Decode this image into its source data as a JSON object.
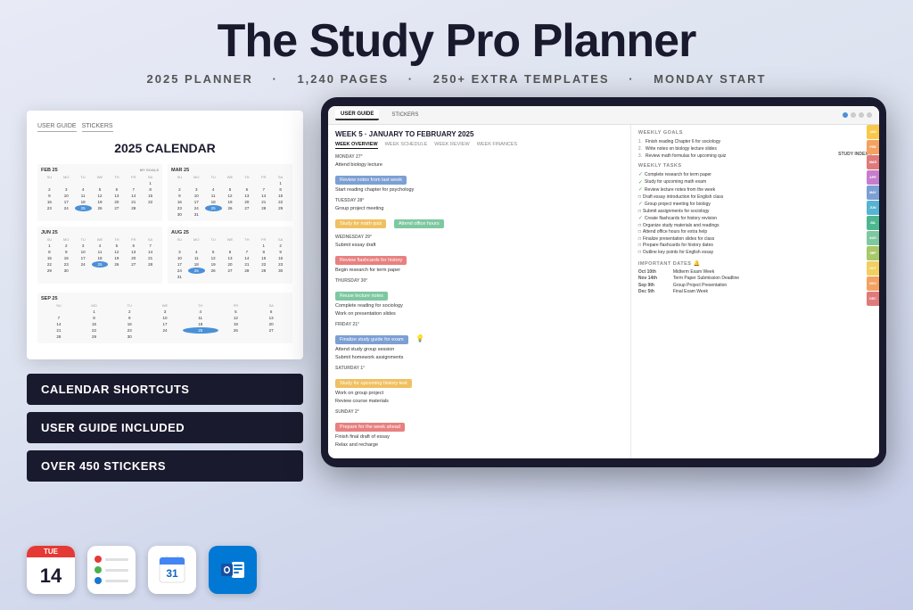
{
  "header": {
    "title": "The Study Pro Planner",
    "subtitle_parts": [
      "2025 PLANNER",
      "1,240 PAGES",
      "250+ EXTRA TEMPLATES",
      "MONDAY START"
    ]
  },
  "left_mockup": {
    "tabs": [
      "USER GUIDE",
      "STICKERS"
    ],
    "calendar_title": "2025 CALENDAR",
    "months": [
      {
        "name": "FEB 25",
        "days_header": [
          "SU",
          "MO",
          "TU",
          "WE",
          "TH",
          "FR",
          "SA"
        ],
        "weeks": [
          "",
          "",
          "",
          "",
          "",
          "",
          "1",
          "2",
          "3",
          "4",
          "5",
          "6",
          "7",
          "8",
          "9",
          "10",
          "11",
          "12",
          "13",
          "14",
          "15",
          "16",
          "17",
          "18",
          "19",
          "20",
          "21",
          "22",
          "23",
          "24",
          "25",
          "26",
          "27",
          "28",
          "",
          ""
        ]
      },
      {
        "name": "MAR 25",
        "days_header": [
          "SU",
          "MO",
          "TU",
          "WE",
          "TH",
          "FR",
          "SA"
        ],
        "weeks": [
          "",
          "",
          "",
          "",
          "",
          "",
          "1",
          "2",
          "3",
          "4",
          "5",
          "6",
          "7",
          "8",
          "9",
          "10",
          "11",
          "12",
          "13",
          "14",
          "15",
          "16",
          "17",
          "18",
          "19",
          "20",
          "21",
          "22",
          "23",
          "24",
          "25",
          "26",
          "27",
          "28",
          "29",
          "30",
          "31"
        ]
      },
      {
        "name": "JUN 25",
        "days_header": [
          "SU",
          "MO",
          "TU",
          "WE",
          "TH",
          "FR",
          "SA"
        ],
        "weeks": [
          "1",
          "2",
          "3",
          "4",
          "5",
          "6",
          "7",
          "8",
          "9",
          "10",
          "11",
          "12",
          "13",
          "14",
          "15",
          "16",
          "17",
          "18",
          "19",
          "20",
          "21",
          "22",
          "23",
          "24",
          "25",
          "26",
          "27",
          "28",
          "29",
          "30",
          "",
          "",
          "",
          "",
          "",
          "",
          ""
        ]
      },
      {
        "name": "AUG 25",
        "days_header": [
          "SU",
          "MO",
          "TU",
          "WE",
          "TH",
          "FR",
          "SA"
        ],
        "weeks": [
          "",
          "",
          "",
          "",
          "",
          "1",
          "2",
          "3",
          "4",
          "5",
          "6",
          "7",
          "8",
          "9",
          "10",
          "11",
          "12",
          "13",
          "14",
          "15",
          "16",
          "17",
          "18",
          "19",
          "20",
          "21",
          "22",
          "23",
          "24",
          "25",
          "26",
          "27",
          "28",
          "29",
          "30",
          "31",
          ""
        ]
      },
      {
        "name": "SEP 25",
        "days_header": [
          "SU",
          "MO",
          "TU",
          "WE",
          "TH",
          "FR",
          "SA"
        ],
        "weeks": [
          "",
          "1",
          "2",
          "3",
          "4",
          "5",
          "6",
          "7",
          "8",
          "9",
          "10",
          "11",
          "12",
          "13",
          "14",
          "15",
          "16",
          "17",
          "18",
          "19",
          "20",
          "21",
          "22",
          "23",
          "24",
          "25",
          "26",
          "27",
          "28",
          "29",
          "30",
          "",
          "",
          "",
          "",
          "",
          ""
        ]
      }
    ]
  },
  "badges": [
    {
      "label": "CALENDAR SHORTCUTS"
    },
    {
      "label": "USER GUIDE INCLUDED"
    },
    {
      "label": "OVER 450 STICKERS"
    }
  ],
  "bottom_icons": [
    {
      "type": "calendar",
      "day_label": "TUE",
      "day_number": "14"
    },
    {
      "type": "reminders",
      "dots": [
        "#e53935",
        "#4caf50",
        "#1976d2"
      ]
    },
    {
      "type": "google_cal"
    },
    {
      "type": "outlook"
    }
  ],
  "tablet": {
    "tabs": [
      "USER GUIDE",
      "STICKERS"
    ],
    "study_index_label": "STUDY INDEX",
    "week_title": "WEEK 5 · JANUARY TO FEBRUARY 2025",
    "week_nav": [
      "WEEK OVERVIEW",
      "WEEK SCHEDULE",
      "WEEK REVIEW",
      "WEEK FINANCES"
    ],
    "days": [
      {
        "label": "MONDAY 27°",
        "tasks": [
          "Attend biology lecture"
        ],
        "highlighted": [
          {
            "text": "Review notes from last week",
            "color": "#7c9fd4"
          }
        ],
        "tasks2": [
          "Start reading chapter for psychology"
        ]
      },
      {
        "label": "TUESDAY 28°",
        "tasks": [
          "Group project meeting"
        ],
        "highlighted": [
          {
            "text": "Study for math quiz",
            "color": "#f0c060"
          },
          {
            "text": "Attend office hours",
            "color": "#7ec8a0"
          }
        ],
        "tasks2": []
      },
      {
        "label": "WEDNESDAY 29°",
        "tasks": [
          "Submit essay draft"
        ],
        "highlighted": [
          {
            "text": "Review flashcards for history",
            "color": "#e88080"
          }
        ],
        "tasks2": [
          "Begin research for term paper"
        ]
      },
      {
        "label": "THURSDAY 30°",
        "tasks": [],
        "highlighted": [
          {
            "text": "Reuse lecture notes",
            "color": "#7ec8a0"
          }
        ],
        "tasks2": [
          "Complete reading for sociology",
          "Work on presentation slides"
        ]
      },
      {
        "label": "FRIDAY 21°",
        "tasks": [],
        "highlighted": [
          {
            "text": "Finalize study guide for exam",
            "color": "#7c9fd4"
          }
        ],
        "tasks2": [
          "Attend study group session",
          "Submit homework assignments"
        ]
      },
      {
        "label": "SATURDAY 1°",
        "tasks": [],
        "highlighted": [
          {
            "text": "Study for upcoming history test",
            "color": "#f0c060"
          }
        ],
        "tasks2": [
          "Work on group project",
          "Review course materials"
        ]
      },
      {
        "label": "SUNDAY 2°",
        "tasks": [],
        "highlighted": [
          {
            "text": "Prepare for the week ahead",
            "color": "#e88080"
          }
        ],
        "tasks2": [
          "Finish final draft of essay",
          "Relax and recharge"
        ]
      }
    ],
    "weekly_goals_title": "WEEKLY GOALS",
    "goals": [
      "Finish reading Chapter 6 for sociology",
      "Write notes on biology lecture slides",
      "Review math formulas for upcoming quiz"
    ],
    "weekly_tasks_title": "WEEKLY TASKS",
    "tasks": [
      "Complete research for term paper",
      "Study for upcoming math exam",
      "Review lecture notes from the week",
      "Draft essay introduction for English class",
      "Group project meeting for biology",
      "Submit assignments for sociology",
      "Create flashcards for history revision",
      "Organize study materials and readings",
      "Attend office hours for extra help",
      "Finalize presentation slides for class",
      "Prepare flashcards for history dates",
      "Outline key points for English essay"
    ],
    "side_tabs": [
      {
        "label": "JAN",
        "color": "#f9c84a"
      },
      {
        "label": "FEB",
        "color": "#f4a261"
      },
      {
        "label": "MAR",
        "color": "#e07a7a"
      },
      {
        "label": "APR",
        "color": "#c77dcc"
      },
      {
        "label": "MAY",
        "color": "#7c9fd4"
      },
      {
        "label": "JUN",
        "color": "#56b4d3"
      },
      {
        "label": "JUL",
        "color": "#4db890"
      },
      {
        "label": "AUG",
        "color": "#7ec8a0"
      },
      {
        "label": "SEP",
        "color": "#a8c86a"
      },
      {
        "label": "OCT",
        "color": "#f0d060"
      },
      {
        "label": "NOV",
        "color": "#f4a261"
      },
      {
        "label": "DEC",
        "color": "#e07a7a"
      }
    ],
    "important_dates_title": "IMPORTANT DATES",
    "important_dates": [
      {
        "date": "Oct 10th",
        "event": "Midterm Exam Week"
      },
      {
        "date": "Nov 14th",
        "event": "Term Paper Submission Deadline"
      },
      {
        "date": "Sep 9th",
        "event": "Group Project Presentation"
      },
      {
        "date": "Dec 5th",
        "event": "Final Exam Week"
      }
    ]
  }
}
